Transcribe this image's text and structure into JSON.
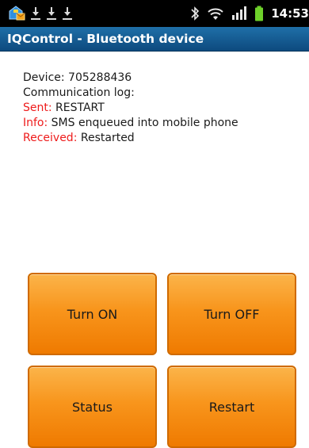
{
  "status_bar": {
    "time": "14:53",
    "notification_icons": [
      "app-notification-icon",
      "download-icon",
      "download-icon",
      "download-icon"
    ],
    "system_icons": [
      "bluetooth-icon",
      "wifi-icon",
      "signal-icon",
      "battery-icon"
    ]
  },
  "title_bar": {
    "title": "IQControl - Bluetooth device"
  },
  "log": {
    "device_line": "Device: 705288436",
    "comm_label": "Communication log:",
    "entries": [
      {
        "label": "Sent:",
        "text": "RESTART"
      },
      {
        "label": "Info:",
        "text": "SMS enqueued into mobile phone"
      },
      {
        "label": "Received:",
        "text": "Restarted"
      }
    ]
  },
  "buttons": {
    "turn_on": "Turn ON",
    "turn_off": "Turn OFF",
    "status": "Status",
    "restart": "Restart"
  },
  "colors": {
    "title_bar": "#1565a0",
    "log_label": "#ee1b1b",
    "button_fill": "#f8951c",
    "button_border": "#cf6a00"
  }
}
